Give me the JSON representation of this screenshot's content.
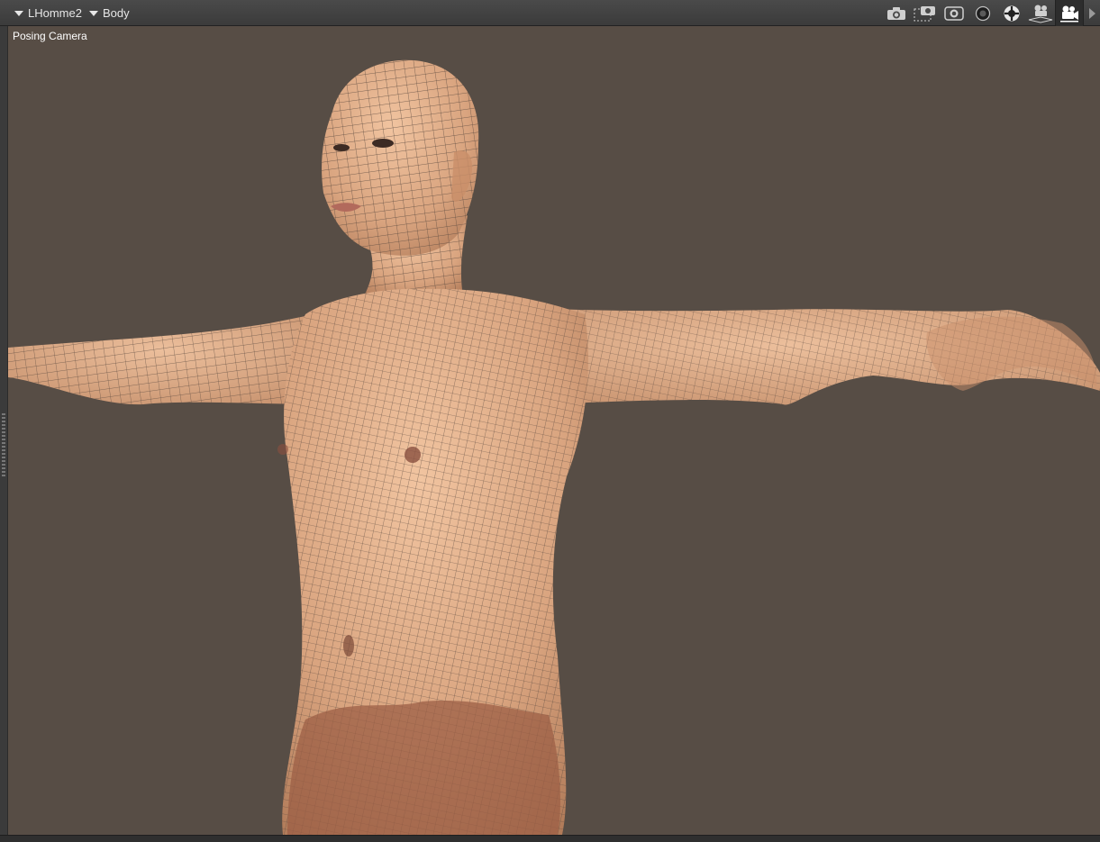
{
  "toolbar": {
    "figure_selector": "LHomme2",
    "node_selector": "Body",
    "icons": [
      "camera-icon",
      "camera-frame-icon",
      "lens-icon",
      "sphere-dark-icon",
      "sphere-lit-icon",
      "perspective-camera-icon",
      "posing-camera-icon",
      "expand-arrow-icon"
    ],
    "active_icon": "posing-camera-icon"
  },
  "viewport": {
    "camera_label": "Posing Camera",
    "background_color": "#574d45",
    "skin_color": "#d9a47f",
    "wire_color": "#5b4a40"
  }
}
